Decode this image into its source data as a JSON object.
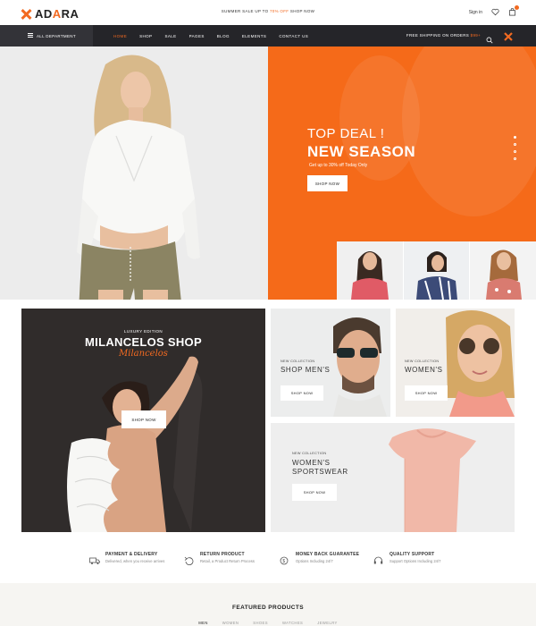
{
  "brand": {
    "name_prefix": "AD",
    "name_accent": "A",
    "name_suffix": "RA"
  },
  "top_bar": {
    "promo_prefix": "SUMMER SALE UP TO",
    "promo_highlight": "70% OFF",
    "promo_suffix": "SHOP NOW",
    "signin_label": "Sign in",
    "wishlist_icon": "heart-icon",
    "cart_icon": "bag-icon"
  },
  "nav": {
    "department_label": "ALL DEPARTMENT",
    "items": [
      "HOME",
      "SHOP",
      "SALE",
      "PAGES",
      "BLOG",
      "ELEMENTS",
      "CONTACT US"
    ],
    "active_index": 0,
    "shipping_prefix": "FREE SHIPPING ON ORDERS",
    "shipping_amount": "$99+"
  },
  "hero": {
    "line1": "TOP DEAL !",
    "line2": "NEW SEASON",
    "subline": "Get up to 30% off Today Only",
    "button": "SHOP NOW",
    "slides": 4,
    "active_slide": 0
  },
  "promo_grid": {
    "big": {
      "kicker": "LUXURY EDITION",
      "title": "MILANCELOS SHOP",
      "script": "Milancelos",
      "button": "SHOP NOW"
    },
    "men": {
      "kicker": "NEW COLLECTION",
      "title": "SHOP MEN'S",
      "button": "SHOP NOW"
    },
    "women": {
      "kicker": "NEW COLLECTION",
      "title": "WOMEN'S",
      "button": "SHOP NOW"
    },
    "sport": {
      "kicker": "NEW COLLECTION",
      "title_line1": "WOMEN'S",
      "title_line2": "SPORTSWEAR",
      "button": "SHOP NOW"
    }
  },
  "services": [
    {
      "icon": "truck-icon",
      "title": "PAYMENT & DELIVERY",
      "text": "Delivered, when you receive arrives"
    },
    {
      "icon": "return-icon",
      "title": "RETURN PRODUCT",
      "text": "Retail, a Product Return Process"
    },
    {
      "icon": "money-icon",
      "title": "MONEY BACK GUARANTEE",
      "text": "Options Including 24/7"
    },
    {
      "icon": "headset-icon",
      "title": "QUALITY SUPPORT",
      "text": "Support Options Including 24/7"
    }
  ],
  "featured": {
    "title": "FEATURED PRODUCTS",
    "tabs": [
      "MEN",
      "WOMEN",
      "SHOES",
      "WATCHES",
      "JEWELRY"
    ],
    "active_tab": 0
  },
  "colors": {
    "accent": "#f26a21",
    "nav_bg": "#252529",
    "hero_bg": "#f56a19"
  }
}
